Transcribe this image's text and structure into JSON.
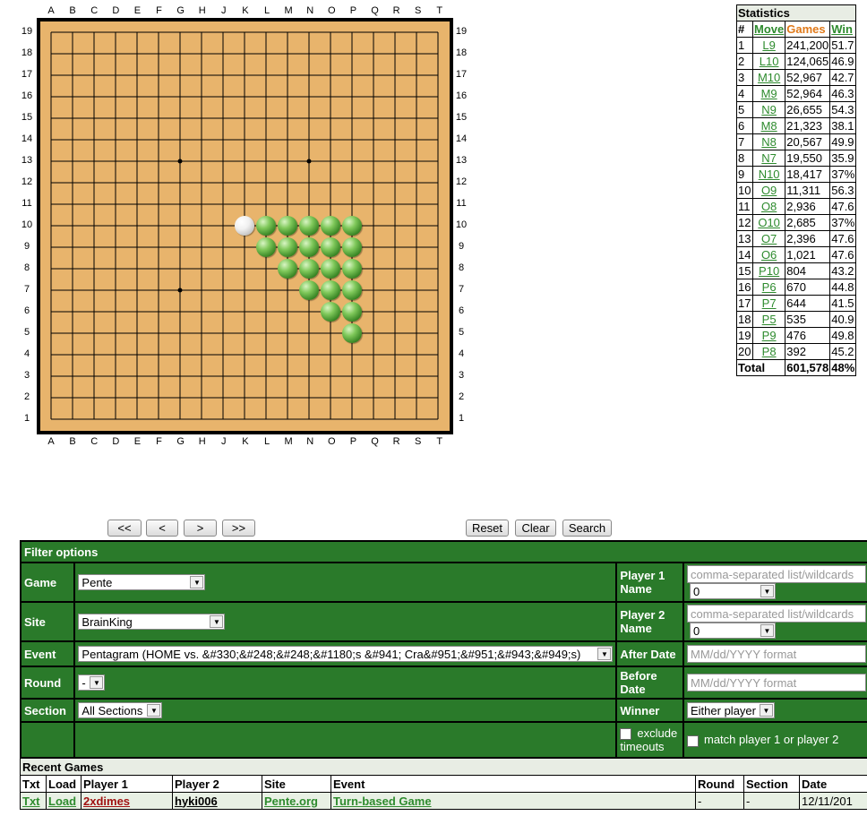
{
  "board": {
    "columns": [
      "A",
      "B",
      "C",
      "D",
      "E",
      "F",
      "G",
      "H",
      "J",
      "K",
      "L",
      "M",
      "N",
      "O",
      "P",
      "Q",
      "R",
      "S",
      "T"
    ],
    "rows": [
      "19",
      "18",
      "17",
      "16",
      "15",
      "14",
      "13",
      "12",
      "11",
      "10",
      "9",
      "8",
      "7",
      "6",
      "5",
      "4",
      "3",
      "2",
      "1"
    ],
    "stones": [
      {
        "pos": "K10",
        "color": "white"
      },
      {
        "pos": "L10",
        "color": "green"
      },
      {
        "pos": "M10",
        "color": "green"
      },
      {
        "pos": "N10",
        "color": "green"
      },
      {
        "pos": "O10",
        "color": "green"
      },
      {
        "pos": "P10",
        "color": "green"
      },
      {
        "pos": "L9",
        "color": "green"
      },
      {
        "pos": "M9",
        "color": "green"
      },
      {
        "pos": "N9",
        "color": "green"
      },
      {
        "pos": "O9",
        "color": "green"
      },
      {
        "pos": "P9",
        "color": "green"
      },
      {
        "pos": "M8",
        "color": "green"
      },
      {
        "pos": "N8",
        "color": "green"
      },
      {
        "pos": "O8",
        "color": "green"
      },
      {
        "pos": "P8",
        "color": "green"
      },
      {
        "pos": "N7",
        "color": "green"
      },
      {
        "pos": "O7",
        "color": "green"
      },
      {
        "pos": "P7",
        "color": "green"
      },
      {
        "pos": "O6",
        "color": "green"
      },
      {
        "pos": "P6",
        "color": "green"
      },
      {
        "pos": "P5",
        "color": "green"
      }
    ],
    "star_points": [
      "G13",
      "N13",
      "G7"
    ],
    "board_color": "#e8b46c"
  },
  "statistics": {
    "title": "Statistics",
    "headers": {
      "num": "#",
      "move": "Move",
      "games": "Games",
      "win": "Win"
    },
    "rows": [
      {
        "n": "1",
        "move": "L9",
        "games": "241,200",
        "win": "51.7"
      },
      {
        "n": "2",
        "move": "L10",
        "games": "124,065",
        "win": "46.9"
      },
      {
        "n": "3",
        "move": "M10",
        "games": "52,967",
        "win": "42.7"
      },
      {
        "n": "4",
        "move": "M9",
        "games": "52,964",
        "win": "46.3"
      },
      {
        "n": "5",
        "move": "N9",
        "games": "26,655",
        "win": "54.3"
      },
      {
        "n": "6",
        "move": "M8",
        "games": "21,323",
        "win": "38.1"
      },
      {
        "n": "7",
        "move": "N8",
        "games": "20,567",
        "win": "49.9"
      },
      {
        "n": "8",
        "move": "N7",
        "games": "19,550",
        "win": "35.9"
      },
      {
        "n": "9",
        "move": "N10",
        "games": "18,417",
        "win": "37%"
      },
      {
        "n": "10",
        "move": "O9",
        "games": "11,311",
        "win": "56.3"
      },
      {
        "n": "11",
        "move": "O8",
        "games": "2,936",
        "win": "47.6"
      },
      {
        "n": "12",
        "move": "O10",
        "games": "2,685",
        "win": "37%"
      },
      {
        "n": "13",
        "move": "O7",
        "games": "2,396",
        "win": "47.6"
      },
      {
        "n": "14",
        "move": "O6",
        "games": "1,021",
        "win": "47.6"
      },
      {
        "n": "15",
        "move": "P10",
        "games": "804",
        "win": "43.2"
      },
      {
        "n": "16",
        "move": "P6",
        "games": "670",
        "win": "44.8"
      },
      {
        "n": "17",
        "move": "P7",
        "games": "644",
        "win": "41.5"
      },
      {
        "n": "18",
        "move": "P5",
        "games": "535",
        "win": "40.9"
      },
      {
        "n": "19",
        "move": "P9",
        "games": "476",
        "win": "49.8"
      },
      {
        "n": "20",
        "move": "P8",
        "games": "392",
        "win": "45.2"
      }
    ],
    "total": {
      "label": "Total",
      "games": "601,578",
      "win": "48%"
    }
  },
  "nav": {
    "first": "<<",
    "prev": "<",
    "next": ">",
    "last": ">>",
    "reset": "Reset",
    "clear": "Clear",
    "search": "Search"
  },
  "filter": {
    "title": "Filter options",
    "game_label": "Game",
    "game_value": "Pente",
    "site_label": "Site",
    "site_value": "BrainKing",
    "event_label": "Event",
    "event_value": "Pentagram (HOME vs. &#330;&#248;&#248;&#1180;s &#941; Cra&#951;&#951;&#943;&#949;s)",
    "round_label": "Round",
    "round_value": "-",
    "section_label": "Section",
    "section_value": "All Sections",
    "p1_label": "Player 1 Name",
    "p1_placeholder": "comma-separated list/wildcards",
    "p1_rating": "0",
    "p2_label": "Player 2 Name",
    "p2_placeholder": "comma-separated list/wildcards",
    "p2_rating": "0",
    "after_label": "After Date",
    "after_placeholder": "MM/dd/YYYY format",
    "before_label": "Before Date",
    "before_placeholder": "MM/dd/YYYY format",
    "winner_label": "Winner",
    "winner_value": "Either player",
    "exclude_label": "exclude timeouts",
    "match_label": "match player 1 or player 2"
  },
  "recent": {
    "title": "Recent Games",
    "headers": {
      "txt": "Txt",
      "load": "Load",
      "p1": "Player 1",
      "p2": "Player 2",
      "site": "Site",
      "event": "Event",
      "round": "Round",
      "section": "Section",
      "date": "Date"
    },
    "rows": [
      {
        "txt": "Txt",
        "load": "Load",
        "p1": "2xdimes",
        "p2": "hyki006",
        "site": "Pente.org",
        "event": "Turn-based Game",
        "round": "-",
        "section": "-",
        "date": "12/11/201"
      }
    ]
  }
}
